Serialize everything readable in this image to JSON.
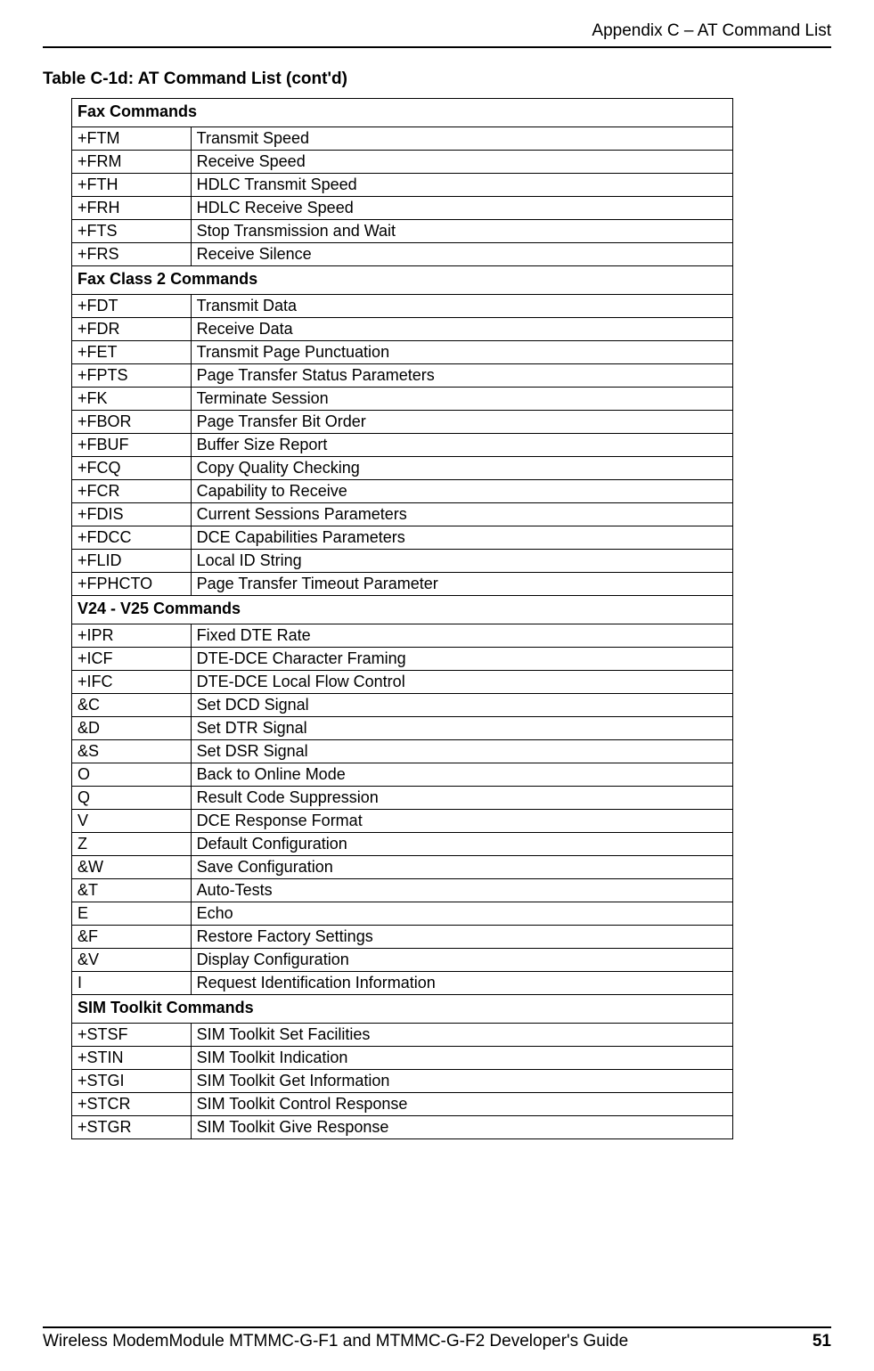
{
  "header": {
    "breadcrumb": "Appendix C – AT Command List"
  },
  "table_title": "Table C-1d: AT Command List (cont'd)",
  "sections": {
    "fax": {
      "header": "Fax Commands",
      "rows": [
        {
          "cmd": "+FTM",
          "desc": "Transmit Speed"
        },
        {
          "cmd": "+FRM",
          "desc": "Receive Speed"
        },
        {
          "cmd": "+FTH",
          "desc": "HDLC Transmit Speed"
        },
        {
          "cmd": "+FRH",
          "desc": "HDLC Receive Speed"
        },
        {
          "cmd": "+FTS",
          "desc": "Stop Transmission and Wait"
        },
        {
          "cmd": "+FRS",
          "desc": "Receive Silence"
        }
      ]
    },
    "fax2": {
      "header": "Fax Class 2 Commands",
      "rows": [
        {
          "cmd": "+FDT",
          "desc": "Transmit Data"
        },
        {
          "cmd": "+FDR",
          "desc": "Receive Data"
        },
        {
          "cmd": "+FET",
          "desc": "Transmit Page Punctuation"
        },
        {
          "cmd": "+FPTS",
          "desc": "Page Transfer Status Parameters"
        },
        {
          "cmd": "+FK",
          "desc": "Terminate Session"
        },
        {
          "cmd": "+FBOR",
          "desc": "Page Transfer Bit Order"
        },
        {
          "cmd": "+FBUF",
          "desc": "Buffer Size Report"
        },
        {
          "cmd": "+FCQ",
          "desc": "Copy Quality Checking"
        },
        {
          "cmd": "+FCR",
          "desc": "Capability to Receive"
        },
        {
          "cmd": "+FDIS",
          "desc": "Current Sessions Parameters"
        },
        {
          "cmd": "+FDCC",
          "desc": "DCE Capabilities Parameters"
        },
        {
          "cmd": "+FLID",
          "desc": "Local ID String"
        },
        {
          "cmd": "+FPHCTO",
          "desc": "Page Transfer Timeout Parameter"
        }
      ]
    },
    "v24": {
      "header": "V24 - V25 Commands",
      "rows": [
        {
          "cmd": "+IPR",
          "desc": "Fixed DTE Rate"
        },
        {
          "cmd": "+ICF",
          "desc": "DTE-DCE Character Framing"
        },
        {
          "cmd": "+IFC",
          "desc": "DTE-DCE Local Flow Control"
        },
        {
          "cmd": "&C",
          "desc": "Set DCD Signal"
        },
        {
          "cmd": "&D",
          "desc": "Set DTR Signal"
        },
        {
          "cmd": "&S",
          "desc": "Set DSR Signal"
        },
        {
          "cmd": "O",
          "desc": "Back to Online Mode"
        },
        {
          "cmd": "Q",
          "desc": "Result Code Suppression"
        },
        {
          "cmd": "V",
          "desc": "DCE Response Format"
        },
        {
          "cmd": "Z",
          "desc": "Default Configuration"
        },
        {
          "cmd": "&W",
          "desc": "Save Configuration"
        },
        {
          "cmd": "&T",
          "desc": "Auto-Tests"
        },
        {
          "cmd": "E",
          "desc": "Echo"
        },
        {
          "cmd": "&F",
          "desc": "Restore Factory Settings"
        },
        {
          "cmd": "&V",
          "desc": "Display Configuration"
        },
        {
          "cmd": "I",
          "desc": "Request Identification Information"
        }
      ]
    },
    "sim": {
      "header": "SIM Toolkit Commands",
      "rows": [
        {
          "cmd": "+STSF",
          "desc": "SIM Toolkit Set Facilities"
        },
        {
          "cmd": "+STIN",
          "desc": "SIM Toolkit Indication"
        },
        {
          "cmd": "+STGI",
          "desc": "SIM Toolkit Get Information"
        },
        {
          "cmd": "+STCR",
          "desc": "SIM Toolkit Control Response"
        },
        {
          "cmd": "+STGR",
          "desc": "SIM Toolkit Give Response"
        }
      ]
    }
  },
  "footer": {
    "text": "Wireless ModemModule MTMMC-G-F1 and MTMMC-G-F2 Developer's Guide",
    "page": "51"
  }
}
